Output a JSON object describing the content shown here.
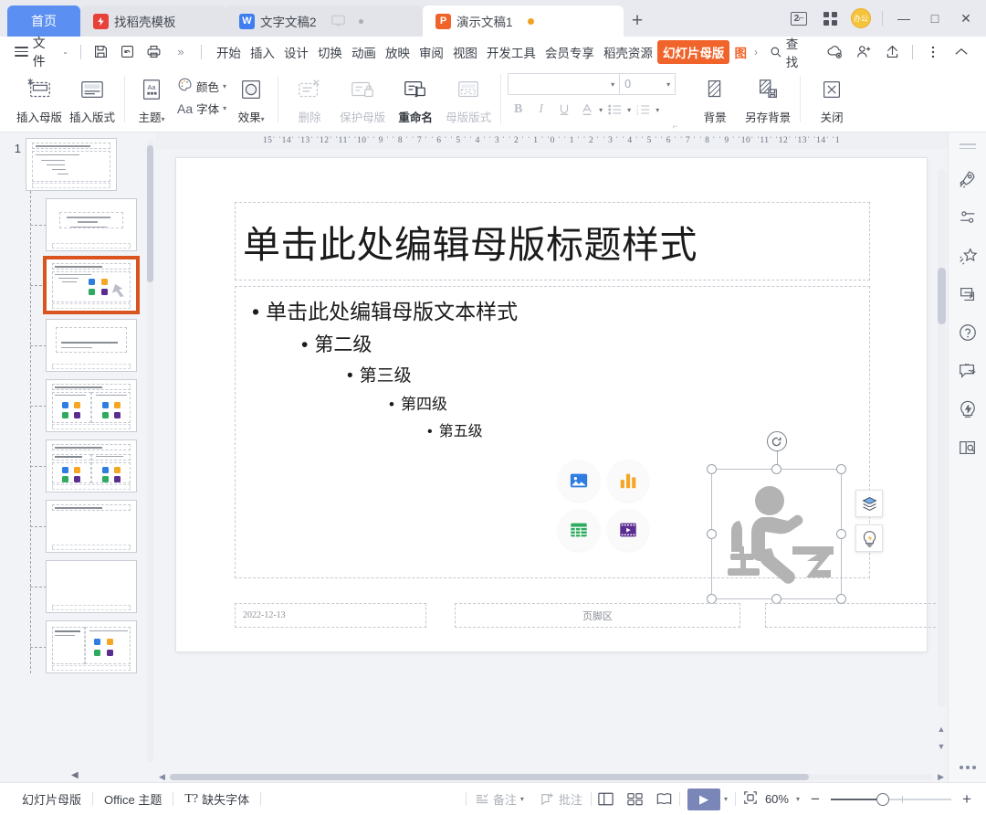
{
  "window": {
    "tabs": [
      {
        "label": "首页",
        "type": "home"
      },
      {
        "label": "找稻壳模板",
        "icon": "docer-icon",
        "type": "inactive"
      },
      {
        "label": "文字文稿2",
        "icon": "writer-icon",
        "type": "inactive"
      },
      {
        "label": "演示文稿1",
        "icon": "presentation-icon",
        "type": "active"
      }
    ],
    "new_tab_label": "+",
    "badge_2p": "2",
    "avatar_label": "办公",
    "minimize": "—",
    "maximize": "□",
    "close": "✕"
  },
  "menubar": {
    "file_label": "文件",
    "quick_access": [
      "save-icon",
      "undo-icon",
      "print-icon",
      "more-icon"
    ],
    "ribbon_tabs": [
      {
        "label": "开始"
      },
      {
        "label": "插入"
      },
      {
        "label": "设计"
      },
      {
        "label": "切换"
      },
      {
        "label": "动画"
      },
      {
        "label": "放映"
      },
      {
        "label": "审阅"
      },
      {
        "label": "视图"
      },
      {
        "label": "开发工具"
      },
      {
        "label": "会员专享"
      },
      {
        "label": "稻壳资源"
      },
      {
        "label": "幻灯片母版",
        "selected": true
      },
      {
        "label": "图",
        "orange": true
      }
    ],
    "overflow": "›",
    "find_label": "查找",
    "right_icons": [
      "cloud-sync-icon",
      "add-user-icon",
      "share-icon",
      "more-vertical-icon",
      "collapse-ribbon-icon"
    ]
  },
  "ribbon": {
    "groups": [
      {
        "items": [
          {
            "label": "插入母版",
            "icon": "insert-master-icon",
            "disabled": false
          },
          {
            "label": "插入版式",
            "icon": "insert-layout-icon",
            "disabled": false
          }
        ]
      },
      {
        "items": [
          {
            "label": "主题",
            "icon": "theme-icon",
            "dropdown": true
          },
          {
            "label": "颜色",
            "icon": "colors-icon",
            "dropdown": true
          },
          {
            "label": "字体",
            "icon": "fonts-icon",
            "dropdown": true
          },
          {
            "label": "效果",
            "icon": "effects-icon",
            "dropdown": true
          }
        ]
      },
      {
        "items": [
          {
            "label": "删除",
            "icon": "delete-master-icon",
            "disabled": true
          },
          {
            "label": "保护母版",
            "icon": "protect-master-icon",
            "disabled": true
          },
          {
            "label": "重命名",
            "icon": "rename-icon",
            "disabled": false,
            "bold": true
          },
          {
            "label": "母版版式",
            "icon": "master-layout-icon",
            "disabled": true
          }
        ]
      },
      {
        "font": {
          "name_value": "",
          "size_value": "0",
          "buttons": [
            "bold-icon",
            "italic-icon",
            "underline-icon",
            "font-color-icon",
            "bullets-icon",
            "numbering-icon"
          ]
        }
      },
      {
        "items": [
          {
            "label": "背景",
            "icon": "background-icon"
          },
          {
            "label": "另存背景",
            "icon": "save-background-icon"
          },
          {
            "label": "关闭",
            "icon": "close-master-icon"
          }
        ]
      }
    ]
  },
  "thumbnails": {
    "master_number": "1",
    "slides": [
      {
        "index": 0,
        "kind": "master",
        "selected": false
      },
      {
        "index": 1,
        "kind": "title",
        "selected": false
      },
      {
        "index": 2,
        "kind": "content",
        "selected": true
      },
      {
        "index": 3,
        "kind": "section",
        "selected": false
      },
      {
        "index": 4,
        "kind": "two-content",
        "selected": false
      },
      {
        "index": 5,
        "kind": "comparison",
        "selected": false
      },
      {
        "index": 6,
        "kind": "title-only",
        "selected": false
      },
      {
        "index": 7,
        "kind": "blank",
        "selected": false
      },
      {
        "index": 8,
        "kind": "caption-content",
        "selected": false
      }
    ]
  },
  "ruler": {
    "left": "15ˈ ˈ14ˈ ˈ13ˈ ˈ12ˈ ˈ11ˈ ˈ10ˈ ˈ 9 ˈ ˈ 8 ˈ ˈ 7 ˈ ˈ 6 ˈ ˈ 5 ˈ ˈ 4 ˈ ˈ 3 ˈ ˈ 2 ˈ ˈ 1 ˈ ˈ",
    "right": "0 ˈ ˈ 1 ˈ ˈ 2 ˈ ˈ 3 ˈ ˈ 4 ˈ ˈ 5 ˈ ˈ 6 ˈ ˈ 7 ˈ ˈ 8 ˈ ˈ 9 ˈ ˈ10ˈ ˈ11ˈ ˈ12ˈ ˈ13ˈ ˈ14ˈ ˈ1"
  },
  "slide": {
    "title": "单击此处编辑母版标题样式",
    "body_levels": [
      "单击此处编辑母版文本样式",
      "第二级",
      "第三级",
      "第四级",
      "第五级"
    ],
    "bullet": "•",
    "date_placeholder": "2022-12-13",
    "footer_placeholder": "页脚区",
    "number_placeholder": "",
    "content_icons": [
      {
        "name": "insert-picture-icon",
        "color": "#2f7de1"
      },
      {
        "name": "insert-chart-icon",
        "color": "#f5a623"
      },
      {
        "name": "insert-table-icon",
        "color": "#2eab5e"
      },
      {
        "name": "insert-video-icon",
        "color": "#5b2d91"
      }
    ],
    "selected_object": {
      "name": "person-at-desk-image",
      "side_tools": [
        "layer-order-icon",
        "smart-design-icon"
      ],
      "rotate_handle": "rotate-icon"
    }
  },
  "right_rail": {
    "icons": [
      "rocket-icon",
      "settings-sliders-icon",
      "magic-star-icon",
      "screen-share-icon",
      "help-circle-icon",
      "feedback-icon",
      "idea-bulb-icon",
      "read-book-icon"
    ],
    "more_label": "more-dots-icon"
  },
  "status": {
    "view_name": "幻灯片母版",
    "theme_name": "Office 主题",
    "missing_font": "缺失字体",
    "notes_label": "备注",
    "comment_label": "批注",
    "view_buttons": [
      "normal-view-icon",
      "slide-sorter-icon",
      "reading-view-icon"
    ],
    "play_label": "▶",
    "fit_label": "fit-to-window-icon",
    "zoom_value": "60%",
    "zoom_out": "−",
    "zoom_in": "+"
  }
}
